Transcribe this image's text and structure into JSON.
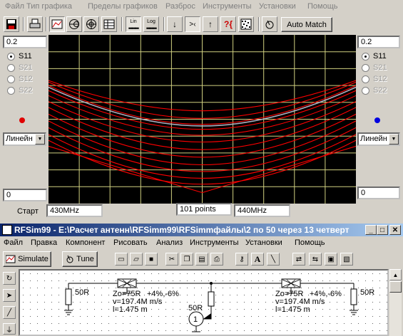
{
  "menu": [
    "Файл",
    "Тип графика",
    "Пределы графиков",
    "Разброс",
    "Инструменты",
    "Установки",
    "Помощь"
  ],
  "toolbar": {
    "lin_label": "Lin",
    "log_label": "Log",
    "auto_match": "Auto Match"
  },
  "left_panel": {
    "top_value": "0.2",
    "bottom_value": "0",
    "scale_select": "Линейн",
    "marker_color": "#e00000",
    "params": [
      {
        "label": "S11",
        "selected": true
      },
      {
        "label": "S21",
        "selected": false
      },
      {
        "label": "S12",
        "selected": false
      },
      {
        "label": "S22",
        "selected": false
      }
    ]
  },
  "right_panel": {
    "top_value": "0.2",
    "bottom_value": "0",
    "scale_select": "Линейн",
    "marker_color": "#0000e0",
    "params": [
      {
        "label": "S11",
        "selected": true
      },
      {
        "label": "S21",
        "selected": false
      },
      {
        "label": "S12",
        "selected": false
      },
      {
        "label": "S22",
        "selected": false
      }
    ]
  },
  "sweep": {
    "start_label": "Старт",
    "start_value": "430MHz",
    "points": "101 points",
    "stop_value": "440MHz"
  },
  "chart_data": {
    "type": "line",
    "title": "",
    "xlabel": "",
    "ylabel": "",
    "xlim": [
      430,
      440
    ],
    "ylim": [
      0,
      0.2
    ],
    "grid": true,
    "background": "#000000",
    "grid_color": "#d0d080",
    "curve_color": "#ff0000",
    "nominal_color": "#b0b0c0",
    "x": [
      430,
      435,
      440
    ],
    "series": [
      {
        "values": [
          0.146,
          0.11,
          0.146
        ]
      },
      {
        "values": [
          0.144,
          0.101,
          0.144
        ]
      },
      {
        "values": [
          0.14,
          0.094,
          0.14
        ]
      },
      {
        "values": [
          0.134,
          0.088,
          0.134
        ]
      },
      {
        "values": [
          0.128,
          0.081,
          0.128
        ]
      },
      {
        "values": [
          0.121,
          0.073,
          0.121
        ]
      },
      {
        "values": [
          0.114,
          0.064,
          0.114
        ]
      },
      {
        "values": [
          0.106,
          0.055,
          0.106
        ]
      },
      {
        "values": [
          0.098,
          0.046,
          0.098
        ]
      },
      {
        "values": [
          0.09,
          0.038,
          0.09
        ]
      },
      {
        "values": [
          0.082,
          0.03,
          0.082
        ]
      },
      {
        "values": [
          0.075,
          0.023,
          0.075
        ]
      },
      {
        "values": [
          0.068,
          0.013,
          0.068
        ]
      }
    ],
    "nominal": {
      "values": [
        0.138,
        0.092,
        0.138
      ]
    }
  },
  "child_window": {
    "title": "RFSim99 - E:\\Расчет антенн\\RFSimm99\\RFSimmфайлы\\2 по 50 через 13 четверте...",
    "menu": [
      "Файл",
      "Правка",
      "Компонент",
      "Рисовать",
      "Анализ",
      "Инструменты",
      "Установки",
      "Помощь"
    ],
    "simulate": "Simulate",
    "tune": "Tune",
    "schematic": {
      "r_left": "50R",
      "r_right": "50R",
      "r_source": "50R",
      "port": "1",
      "line_left": {
        "zo": "Zo=75R",
        "tol": "+4%,-6%",
        "v": "v=197.4M m/s",
        "l": "l=1.475 m"
      },
      "line_right": {
        "zo": "Zo=75R",
        "tol": "+4%,-6%",
        "v": "v=197.4M m/s",
        "l": "l=1.475 m"
      }
    }
  }
}
